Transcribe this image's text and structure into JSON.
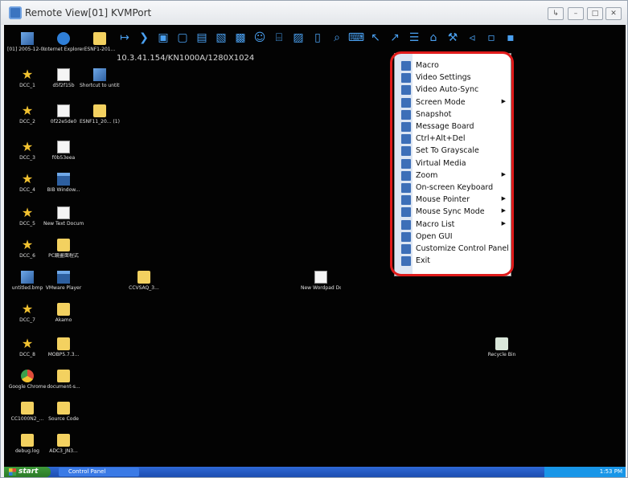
{
  "window": {
    "title": "Remote View[01] KVMPort",
    "icon": "kvm-app-icon",
    "controls": [
      "pin-icon",
      "minimize-icon",
      "maximize-icon",
      "close-icon"
    ]
  },
  "toolbar": {
    "icons": [
      "pin-toolbar-icon",
      "collapse-toolbar-icon",
      "macro-icon",
      "video-settings-icon",
      "video-autosync-icon",
      "screen-mode-icon",
      "snapshot-icon",
      "message-board-icon",
      "ctrl-alt-del-icon",
      "grayscale-icon",
      "virtual-media-icon",
      "zoom-icon",
      "onscreen-keyboard-icon",
      "mouse-pointer-icon",
      "mouse-sync-icon",
      "macro-list-icon",
      "open-gui-icon",
      "customize-panel-icon",
      "exit-icon",
      "extra-icon-1",
      "extra-icon-2"
    ]
  },
  "address": "10.3.41.154/KN1000A/1280X1024",
  "desktop_icons": [
    {
      "label": "[01] 2005-12-0...",
      "type": "img"
    },
    {
      "label": "Internet Explorer",
      "type": "ie"
    },
    {
      "label": "ESNF1-201...",
      "type": "folder"
    },
    {
      "label": "DCC_1",
      "type": "star"
    },
    {
      "label": "d5f2f15b",
      "type": "doc"
    },
    {
      "label": "Shortcut to untitled.bmp",
      "type": "img"
    },
    {
      "label": "DCC_2",
      "type": "star"
    },
    {
      "label": "0f22e5de0",
      "type": "doc"
    },
    {
      "label": "ESNF11_20... (1)-fb",
      "type": "folder"
    },
    {
      "label": "DCC_3",
      "type": "star"
    },
    {
      "label": "f0b53eea",
      "type": "doc"
    },
    {
      "label": "DCC_4",
      "type": "star"
    },
    {
      "label": "BIB Window...",
      "type": "window"
    },
    {
      "label": "DCC_5",
      "type": "star"
    },
    {
      "label": "New Text Document.txt",
      "type": "doc"
    },
    {
      "label": "DCC_6",
      "type": "star"
    },
    {
      "label": "PC鏡畫面程式",
      "type": "folder"
    },
    {
      "label": "untitled.bmp",
      "type": "img"
    },
    {
      "label": "VMware Player",
      "type": "window"
    },
    {
      "label": "CCVSAQ_3...",
      "type": "folder"
    },
    {
      "label": "New Wordpad Document.doc",
      "type": "doc"
    },
    {
      "label": "DCC_7",
      "type": "star"
    },
    {
      "label": "Akamo",
      "type": "folder"
    },
    {
      "label": "DCC_8",
      "type": "star"
    },
    {
      "label": "MOBP5.7.3...",
      "type": "folder"
    },
    {
      "label": "Recycle Bin",
      "type": "recycle"
    },
    {
      "label": "Google Chrome",
      "type": "chrome"
    },
    {
      "label": "document-s...",
      "type": "folder"
    },
    {
      "label": "CC1000N2_...",
      "type": "folder"
    },
    {
      "label": "Source Code",
      "type": "folder"
    },
    {
      "label": "debug.log",
      "type": "folder"
    },
    {
      "label": "ADC3_JN3...",
      "type": "folder"
    }
  ],
  "menu": {
    "items": [
      {
        "label": "Macro",
        "icon": "macro-icon",
        "submenu": false
      },
      {
        "label": "Video Settings",
        "icon": "video-settings-icon",
        "submenu": false
      },
      {
        "label": "Video Auto-Sync",
        "icon": "video-autosync-icon",
        "submenu": false
      },
      {
        "label": "Screen Mode",
        "icon": "screen-mode-icon",
        "submenu": true
      },
      {
        "label": "Snapshot",
        "icon": "snapshot-icon",
        "submenu": false
      },
      {
        "label": "Message Board",
        "icon": "message-board-icon",
        "submenu": false
      },
      {
        "label": "Ctrl+Alt+Del",
        "icon": "ctrl-alt-del-icon",
        "submenu": false
      },
      {
        "label": "Set To Grayscale",
        "icon": "grayscale-icon",
        "submenu": false
      },
      {
        "label": "Virtual Media",
        "icon": "virtual-media-icon",
        "submenu": false
      },
      {
        "label": "Zoom",
        "icon": "zoom-icon",
        "submenu": true
      },
      {
        "label": "On-screen Keyboard",
        "icon": "onscreen-keyboard-icon",
        "submenu": false
      },
      {
        "label": "Mouse Pointer",
        "icon": "mouse-pointer-icon",
        "submenu": true
      },
      {
        "label": "Mouse Sync Mode",
        "icon": "mouse-sync-icon",
        "submenu": true
      },
      {
        "label": "Macro List",
        "icon": "macro-list-icon",
        "submenu": true
      },
      {
        "label": "Open GUI",
        "icon": "open-gui-icon",
        "submenu": false
      },
      {
        "label": "Customize Control Panel",
        "icon": "customize-panel-icon",
        "submenu": false
      },
      {
        "label": "Exit",
        "icon": "exit-icon",
        "submenu": false
      }
    ]
  },
  "taskbar": {
    "start_label": "start",
    "task_item": "Control Panel",
    "clock": "1:53 PM"
  },
  "colors": {
    "highlight": "#e01b1b",
    "desktop": "#030303",
    "menu_strip": "#dde6f3"
  }
}
